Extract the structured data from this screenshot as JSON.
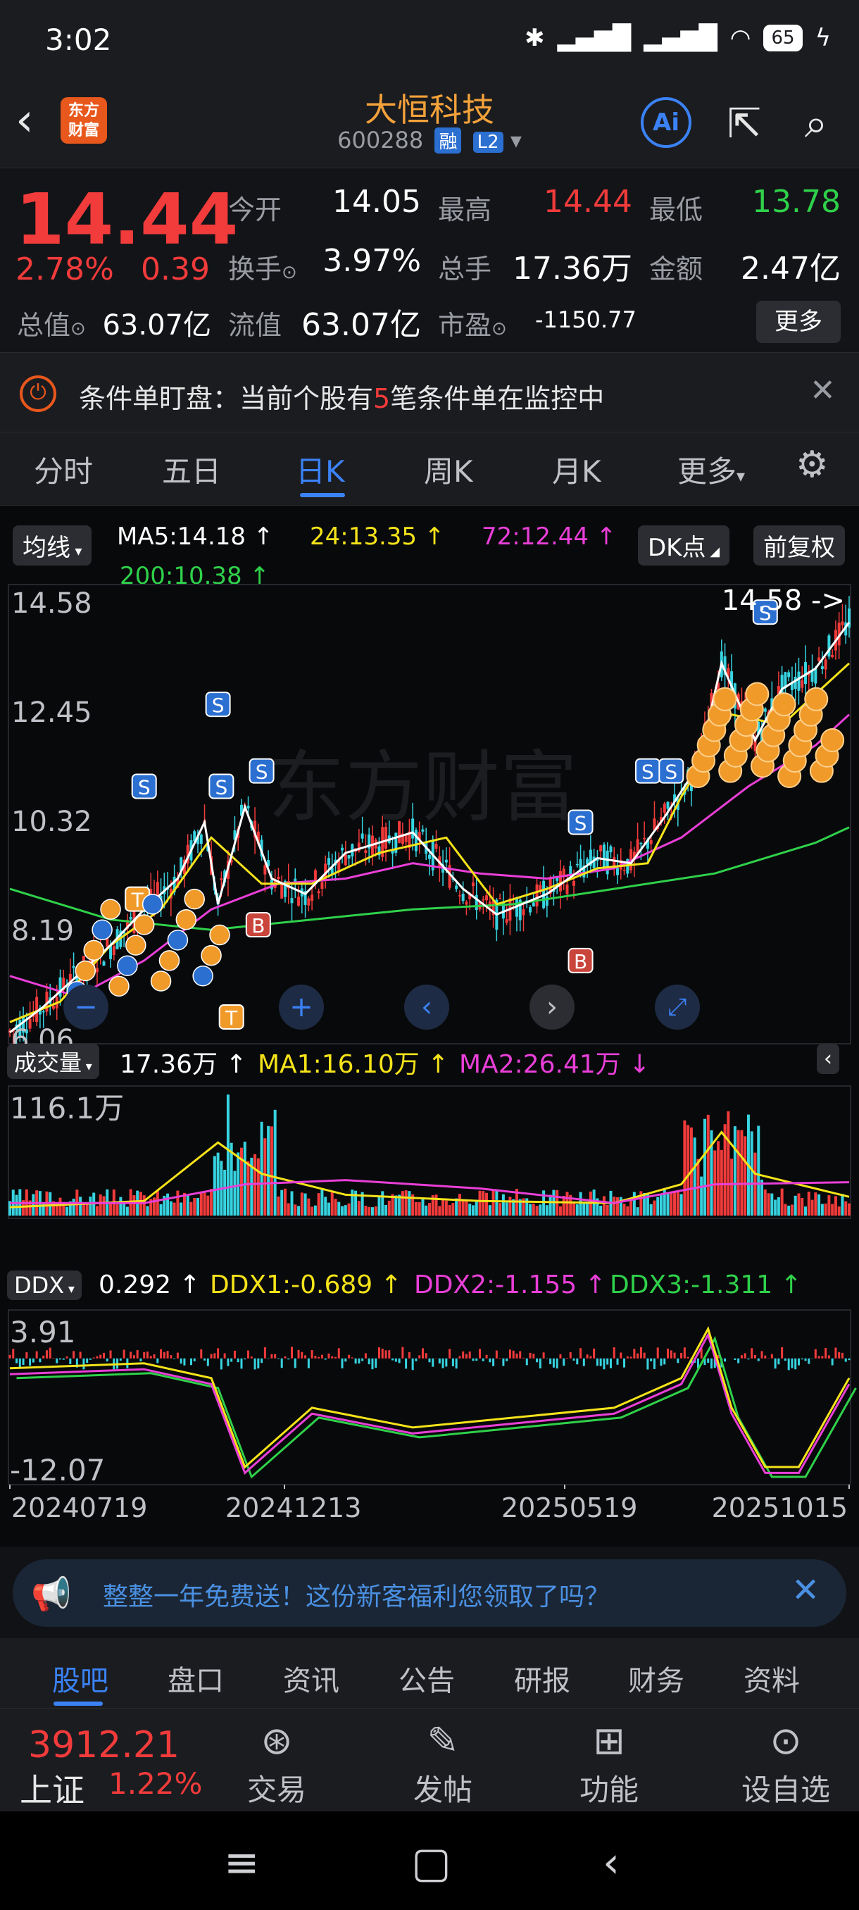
{
  "status_bar": {
    "time": "3:02",
    "icons": [
      "bluetooth-icon",
      "signal-icon",
      "signal-icon",
      "wifi-icon",
      "charging-icon"
    ],
    "battery": "65"
  },
  "header": {
    "logo_text": "东方\n财富",
    "stock_name": "大恒科技",
    "stock_code": "600288",
    "tag_margin": "融",
    "tag_level": "L2",
    "ai_label": "Ai"
  },
  "quote": {
    "price": "14.44",
    "change_pct": "2.78%",
    "change_amt": "0.39",
    "fields": [
      {
        "label": "今开",
        "value": "14.05",
        "color": "#ffffff"
      },
      {
        "label": "最高",
        "value": "14.44",
        "color": "#f23b3b"
      },
      {
        "label": "最低",
        "value": "13.78",
        "color": "#2fd14a"
      },
      {
        "label": "换手",
        "value": "3.97%",
        "color": "#ffffff"
      },
      {
        "label": "总手",
        "value": "17.36万",
        "color": "#ffffff"
      },
      {
        "label": "金额",
        "value": "2.47亿",
        "color": "#ffffff"
      },
      {
        "label": "总值",
        "value": "63.07亿",
        "color": "#ffffff"
      },
      {
        "label": "流值",
        "value": "63.07亿",
        "color": "#ffffff"
      },
      {
        "label": "市盈",
        "value": "-1150.77",
        "color": "#ffffff"
      }
    ],
    "more_label": "更多"
  },
  "notice": {
    "prefix": "条件单盯盘：当前个股有",
    "count": "5",
    "suffix": "笔条件单在监控中"
  },
  "period_tabs": [
    "分时",
    "五日",
    "日K",
    "周K",
    "月K",
    "更多"
  ],
  "active_tab": "日K",
  "indicators": {
    "main_selector": "均线",
    "ma5": "MA5:14.18",
    "ma24": "24:13.35",
    "ma72": "72:12.44",
    "ma200": "200:10.38",
    "dk_label": "DK点",
    "adjust_label": "前复权",
    "vol_selector": "成交量",
    "vol": "17.36万",
    "vol_ma1": "MA1:16.10万",
    "vol_ma2": "MA2:26.41万",
    "ddx_selector": "DDX",
    "ddx": "0.292",
    "ddx1": "DDX1:-0.689",
    "ddx2": "DDX2:-1.155",
    "ddx3": "DDX3:-1.311"
  },
  "chart_data": [
    {
      "type": "candlestick",
      "title": "",
      "y_ticks": [
        "14.58",
        "12.45",
        "10.32",
        "8.19",
        "6.06"
      ],
      "ylim": [
        6.06,
        14.58
      ],
      "max_label": "14.58",
      "series": [
        {
          "name": "MA5",
          "color": "#ffffff"
        },
        {
          "name": "24",
          "color": "#f5e31a"
        },
        {
          "name": "72",
          "color": "#e93fd7"
        },
        {
          "name": "200",
          "color": "#2fd14a"
        }
      ],
      "ma200_points": [
        [
          0,
          9.0
        ],
        [
          30,
          8.4
        ],
        [
          60,
          8.2
        ],
        [
          90,
          8.4
        ],
        [
          120,
          8.6
        ],
        [
          150,
          8.7
        ],
        [
          180,
          9.0
        ],
        [
          210,
          9.3
        ],
        [
          240,
          9.9
        ],
        [
          250,
          10.2
        ]
      ],
      "ma72_points": [
        [
          0,
          7.3
        ],
        [
          20,
          6.9
        ],
        [
          40,
          7.6
        ],
        [
          60,
          8.6
        ],
        [
          80,
          9.1
        ],
        [
          100,
          9.2
        ],
        [
          120,
          9.5
        ],
        [
          140,
          9.3
        ],
        [
          160,
          9.2
        ],
        [
          180,
          9.4
        ],
        [
          200,
          10.0
        ],
        [
          220,
          11.0
        ],
        [
          240,
          11.8
        ],
        [
          250,
          12.4
        ]
      ],
      "ma24_points": [
        [
          0,
          6.4
        ],
        [
          15,
          6.8
        ],
        [
          30,
          7.9
        ],
        [
          45,
          8.6
        ],
        [
          60,
          10.0
        ],
        [
          75,
          9.1
        ],
        [
          90,
          9.1
        ],
        [
          110,
          9.7
        ],
        [
          130,
          10.0
        ],
        [
          145,
          8.7
        ],
        [
          160,
          9.0
        ],
        [
          175,
          9.4
        ],
        [
          190,
          9.5
        ],
        [
          200,
          10.8
        ],
        [
          215,
          12.4
        ],
        [
          230,
          12.2
        ],
        [
          240,
          12.8
        ],
        [
          250,
          13.4
        ]
      ],
      "ma5_points": [
        [
          0,
          6.2
        ],
        [
          10,
          6.7
        ],
        [
          20,
          7.3
        ],
        [
          30,
          7.9
        ],
        [
          40,
          8.6
        ],
        [
          50,
          9.2
        ],
        [
          58,
          10.3
        ],
        [
          62,
          8.7
        ],
        [
          70,
          10.6
        ],
        [
          78,
          9.2
        ],
        [
          88,
          8.9
        ],
        [
          100,
          9.7
        ],
        [
          120,
          10.1
        ],
        [
          135,
          9.0
        ],
        [
          145,
          8.5
        ],
        [
          160,
          8.9
        ],
        [
          175,
          9.6
        ],
        [
          185,
          9.5
        ],
        [
          195,
          10.4
        ],
        [
          205,
          11.4
        ],
        [
          212,
          13.4
        ],
        [
          222,
          11.9
        ],
        [
          230,
          12.9
        ],
        [
          240,
          13.3
        ],
        [
          250,
          14.2
        ]
      ],
      "markers": [
        {
          "label": "S",
          "x": 40,
          "y": 11.0
        },
        {
          "label": "S",
          "x": 62,
          "y": 12.6
        },
        {
          "label": "S",
          "x": 75,
          "y": 11.3
        },
        {
          "label": "S",
          "x": 63,
          "y": 11.0
        },
        {
          "label": "S",
          "x": 170,
          "y": 10.3
        },
        {
          "label": "S",
          "x": 190,
          "y": 11.3
        },
        {
          "label": "S",
          "x": 197,
          "y": 11.3
        },
        {
          "label": "S",
          "x": 225,
          "y": 14.4
        },
        {
          "label": "B",
          "x": 74,
          "y": 8.3
        },
        {
          "label": "B",
          "x": 170,
          "y": 7.6
        },
        {
          "label": "T",
          "x": 38,
          "y": 8.8
        },
        {
          "label": "T",
          "x": 66,
          "y": 6.5
        }
      ],
      "bottom_left_label": "6.06"
    },
    {
      "type": "bar",
      "title": "",
      "y_ticks": [
        "116.1万"
      ],
      "ylim": [
        0,
        116.1
      ]
    },
    {
      "type": "line",
      "title": "",
      "y_ticks": [
        "3.91",
        "-12.07"
      ],
      "ylim": [
        -12.07,
        3.91
      ],
      "x_ticks": [
        "20240719",
        "20241213",
        "20250519",
        "20251015"
      ]
    }
  ],
  "banner": {
    "text": "整整一年免费送！这份新客福利您领取了吗？"
  },
  "bottom_tabs": [
    "股吧",
    "盘口",
    "资讯",
    "公告",
    "研报",
    "财务",
    "资料"
  ],
  "active_bottom_tab": "股吧",
  "index": {
    "value": "3912.21",
    "name": "上证",
    "pct": "1.22%"
  },
  "tools": [
    {
      "icon": "trade-icon",
      "label": "交易"
    },
    {
      "icon": "post-icon",
      "label": "发帖"
    },
    {
      "icon": "grid-icon",
      "label": "功能"
    },
    {
      "icon": "more-icon",
      "label": "设自选"
    }
  ],
  "watermark": "东方财富"
}
